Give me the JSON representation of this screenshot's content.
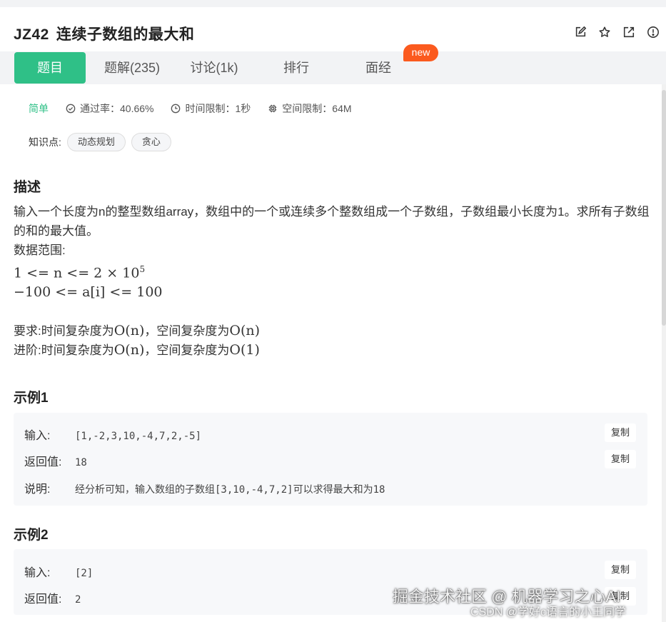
{
  "problem": {
    "code": "JZ42",
    "title": "连续子数组的最大和"
  },
  "actions": [
    {
      "name": "edit-icon"
    },
    {
      "name": "star-icon"
    },
    {
      "name": "share-icon"
    },
    {
      "name": "info-icon"
    }
  ],
  "tabs": {
    "problem": "题目",
    "solutions": "题解(235)",
    "discuss": "讨论(1k)",
    "ranking": "排行",
    "interview": "面经",
    "new_badge": "new"
  },
  "meta": {
    "difficulty": "简单",
    "pass_rate": "通过率：40.66%",
    "time_limit": "时间限制：1秒",
    "memory_limit": "空间限制：64M"
  },
  "knowledge": {
    "label": "知识点:",
    "tags": [
      "动态规划",
      "贪心"
    ]
  },
  "description": {
    "heading": "描述",
    "text": "输入一个长度为n的整型数组array，数组中的一个或连续多个整数组成一个子数组，子数组最小长度为1。求所有子数组的和的最大值。",
    "range_label": "数据范围:",
    "range1": "1 <= n <= 2 × 10",
    "range1_exp": "5",
    "range2": "−100 <= a[i] <= 100",
    "req_prefix": "要求:时间复杂度为",
    "req_time": "O(n)",
    "req_mid": "，空间复杂度为",
    "req_space": "O(n)",
    "adv_prefix": "进阶:时间复杂度为",
    "adv_time": "O(n)",
    "adv_mid": "，空间复杂度为",
    "adv_space": "O(1)"
  },
  "example1": {
    "heading": "示例1",
    "input_label": "输入:",
    "input": "[1,-2,3,10,-4,7,2,-5]",
    "output_label": "返回值:",
    "output": "18",
    "explain_label": "说明:",
    "explain": "经分析可知，输入数组的子数组[3,10,-4,7,2]可以求得最大和为18",
    "copy": "复制"
  },
  "example2": {
    "heading": "示例2",
    "input_label": "输入:",
    "input": "[2]",
    "output_label": "返回值:",
    "output": "2",
    "copy": "复制"
  },
  "watermark": {
    "line1": "掘金技术社区 @ 机器学习之心AI",
    "line2": "CSDN @学好c语言的小王同学"
  },
  "colors": {
    "accent": "#2fc087",
    "badge": "#fb5a1e",
    "tabbar_bg": "#f2f3f5",
    "example_bg": "#f7f8fa"
  }
}
